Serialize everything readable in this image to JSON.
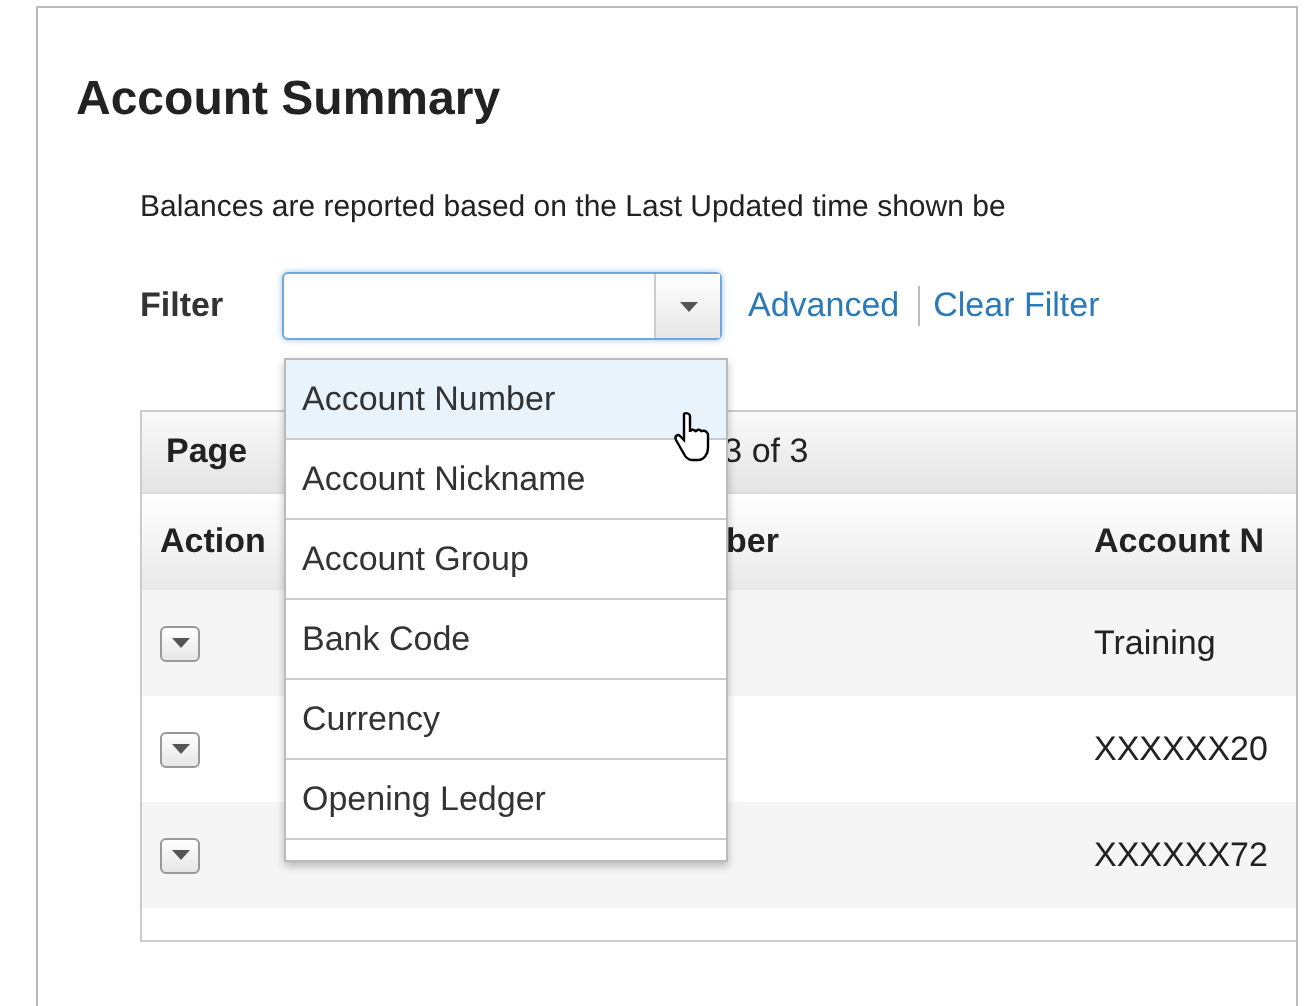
{
  "title": "Account Summary",
  "description": "Balances are reported based on the Last Updated time shown be",
  "filter": {
    "label": "Filter",
    "links": [
      "Advanced",
      "Clear Filter"
    ]
  },
  "dropdown": {
    "items": [
      {
        "label": "Account Number",
        "selected": true
      },
      {
        "label": "Account Nickname",
        "selected": false
      },
      {
        "label": "Account Group",
        "selected": false
      },
      {
        "label": "Bank Code",
        "selected": false
      },
      {
        "label": "Currency",
        "selected": false
      },
      {
        "label": "Opening Ledger",
        "selected": false
      }
    ]
  },
  "table": {
    "page_label": "Page",
    "page_count": "3 of 3",
    "columns": [
      "Action",
      "ber",
      "Account N"
    ],
    "rows": [
      {
        "account_nickname": "Training"
      },
      {
        "account_nickname": "XXXXXX20"
      },
      {
        "account_nickname": "XXXXXX72"
      }
    ]
  }
}
